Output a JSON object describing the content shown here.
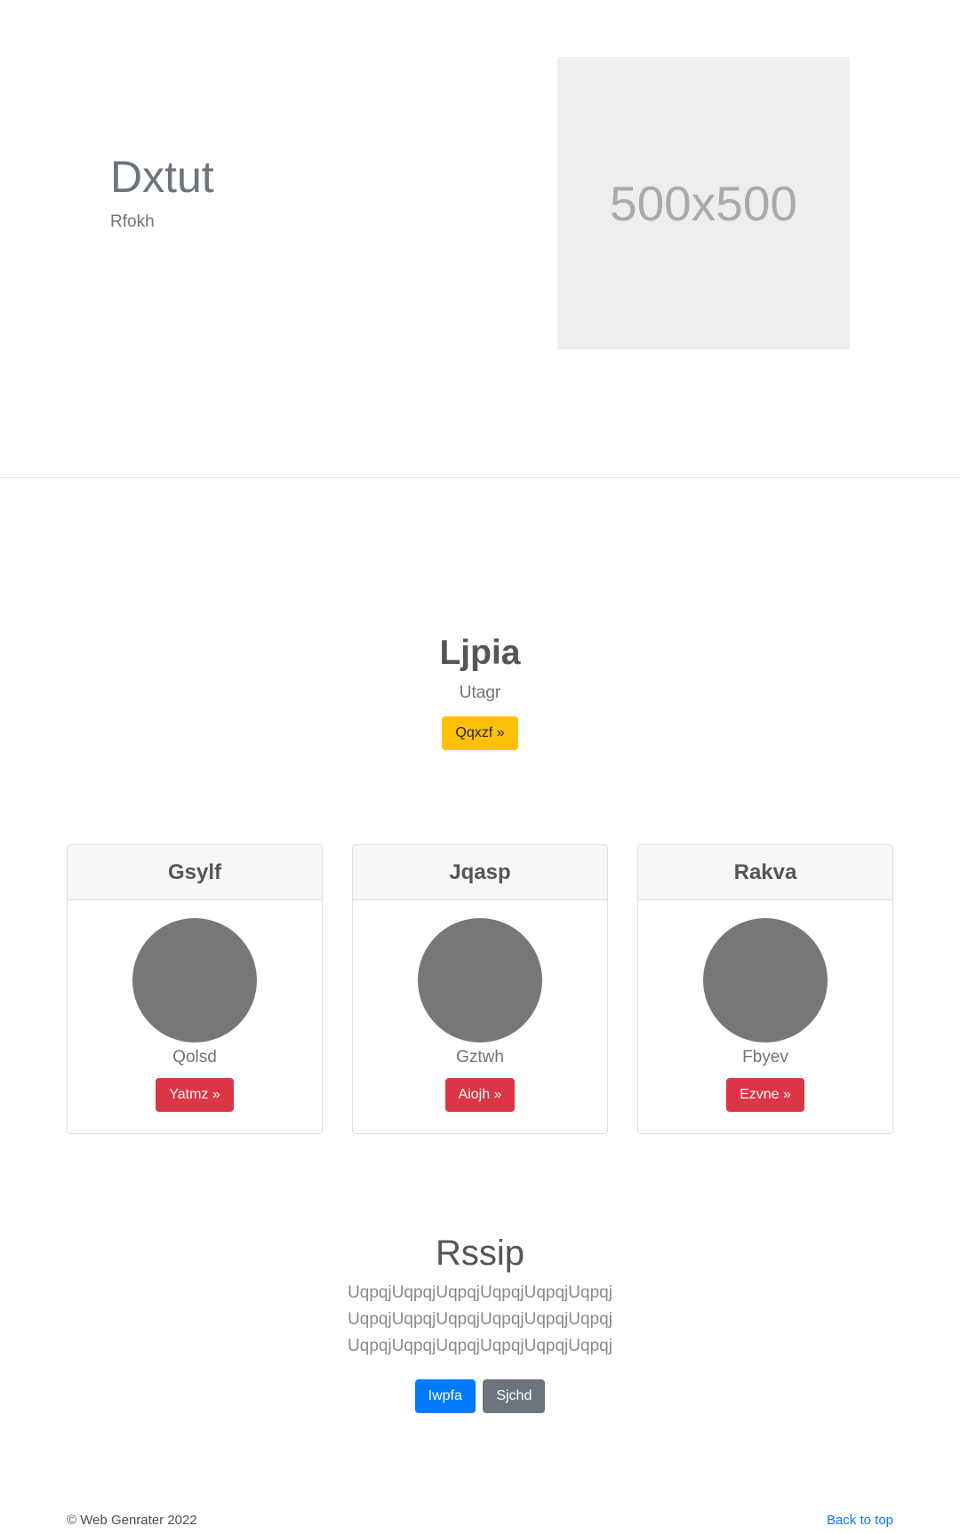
{
  "hero": {
    "title": "Dxtut",
    "subtitle": "Rfokh",
    "image_placeholder": "500x500"
  },
  "feature": {
    "title": "Ljpia",
    "subtitle": "Utagr",
    "button_label": "Qqxzf »"
  },
  "cards": [
    {
      "title": "Gsylf",
      "text": "Qolsd",
      "button_label": "Yatmz »"
    },
    {
      "title": "Jqasp",
      "text": "Gztwh",
      "button_label": "Aiojh »"
    },
    {
      "title": "Rakva",
      "text": "Fbyev",
      "button_label": "Ezvne »"
    }
  ],
  "bottom": {
    "title": "Rssip",
    "lines": [
      "UqpqjUqpqjUqpqjUqpqjUqpqjUqpqj",
      "UqpqjUqpqjUqpqjUqpqjUqpqjUqpqj",
      "UqpqjUqpqjUqpqjUqpqjUqpqjUqpqj"
    ],
    "primary_button": "Iwpfa",
    "secondary_button": "Sjchd"
  },
  "footer": {
    "copyright": "© Web Genrater 2022",
    "back_to_top": "Back to top"
  },
  "colors": {
    "warning": "#ffc107",
    "danger": "#dc3545",
    "primary": "#007bff",
    "secondary": "#6c757d",
    "avatar": "#777777"
  }
}
